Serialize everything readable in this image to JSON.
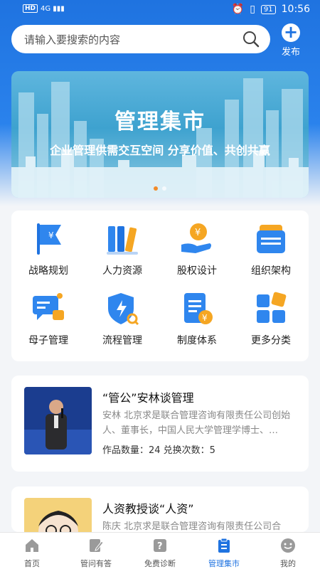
{
  "status": {
    "left": "HD 4G",
    "time": "10:56",
    "battery": "91"
  },
  "search": {
    "placeholder": "请输入要搜索的内容"
  },
  "publish": {
    "label": "发布"
  },
  "banner": {
    "title": "管理集市",
    "subtitle": "企业管理供需交互空间  分享价值、共创共赢"
  },
  "categories": [
    {
      "label": "战略规划",
      "icon": "flag-icon"
    },
    {
      "label": "人力资源",
      "icon": "books-icon"
    },
    {
      "label": "股权设计",
      "icon": "coin-hand-icon"
    },
    {
      "label": "组织架构",
      "icon": "wallet-icon"
    },
    {
      "label": "母子管理",
      "icon": "chat-icon"
    },
    {
      "label": "流程管理",
      "icon": "shield-icon"
    },
    {
      "label": "制度体系",
      "icon": "document-icon"
    },
    {
      "label": "更多分类",
      "icon": "grid-icon"
    }
  ],
  "cards": [
    {
      "title": "“管公”安林谈管理",
      "desc": "安林  北京求是联合管理咨询有限责任公司创始人、董事长，中国人民大学管理学博士、…",
      "meta": "作品数量：24   兑换次数：5"
    },
    {
      "title": "人资教授谈“人资”",
      "desc": "陈庆  北京求是联合管理咨询有限责任公司合"
    }
  ],
  "tabs": [
    {
      "label": "首页"
    },
    {
      "label": "管问有答"
    },
    {
      "label": "免费诊断"
    },
    {
      "label": "管理集市"
    },
    {
      "label": "我的"
    }
  ],
  "colors": {
    "primary": "#1f73e0",
    "accent": "#f5a623"
  }
}
